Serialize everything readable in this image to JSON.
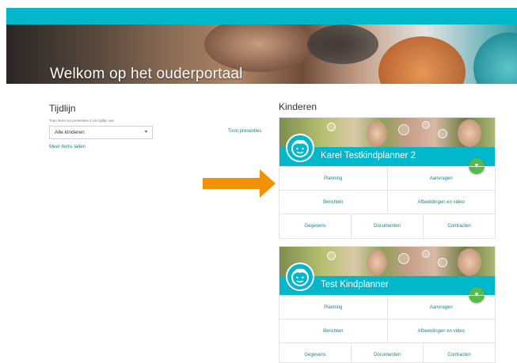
{
  "colors": {
    "accent": "#00b7cc",
    "link": "#1c7f86",
    "toggle": "#57b94e",
    "arrow": "#f39200"
  },
  "hero": {
    "title": "Welkom op het ouderportaal"
  },
  "timeline": {
    "title": "Tijdlijn",
    "subtitle": "Toon items en presenties in de tijdlijn van",
    "select_value": "Alle kinderen",
    "show_presences": "Toon presenties",
    "load_more": "Meer items laden"
  },
  "children": {
    "title": "Kinderen",
    "cards": [
      {
        "name": "Karel Testkindplanner 2",
        "toggle_icon": "chevron-down-icon",
        "row1": [
          "Planning",
          "Aanvragen"
        ],
        "row2": [
          "Berichten",
          "Afbeeldingen en video"
        ],
        "row3": [
          "Gegevens",
          "Documenten",
          "Contracten"
        ]
      },
      {
        "name": "Test Kindplanner",
        "toggle_icon": "chevron-down-icon",
        "row1": [
          "Planning",
          "Aanvragen"
        ],
        "row2": [
          "Berichten",
          "Afbeeldingen en video"
        ],
        "row3": [
          "Gegevens",
          "Documenten",
          "Contracten"
        ]
      }
    ]
  }
}
